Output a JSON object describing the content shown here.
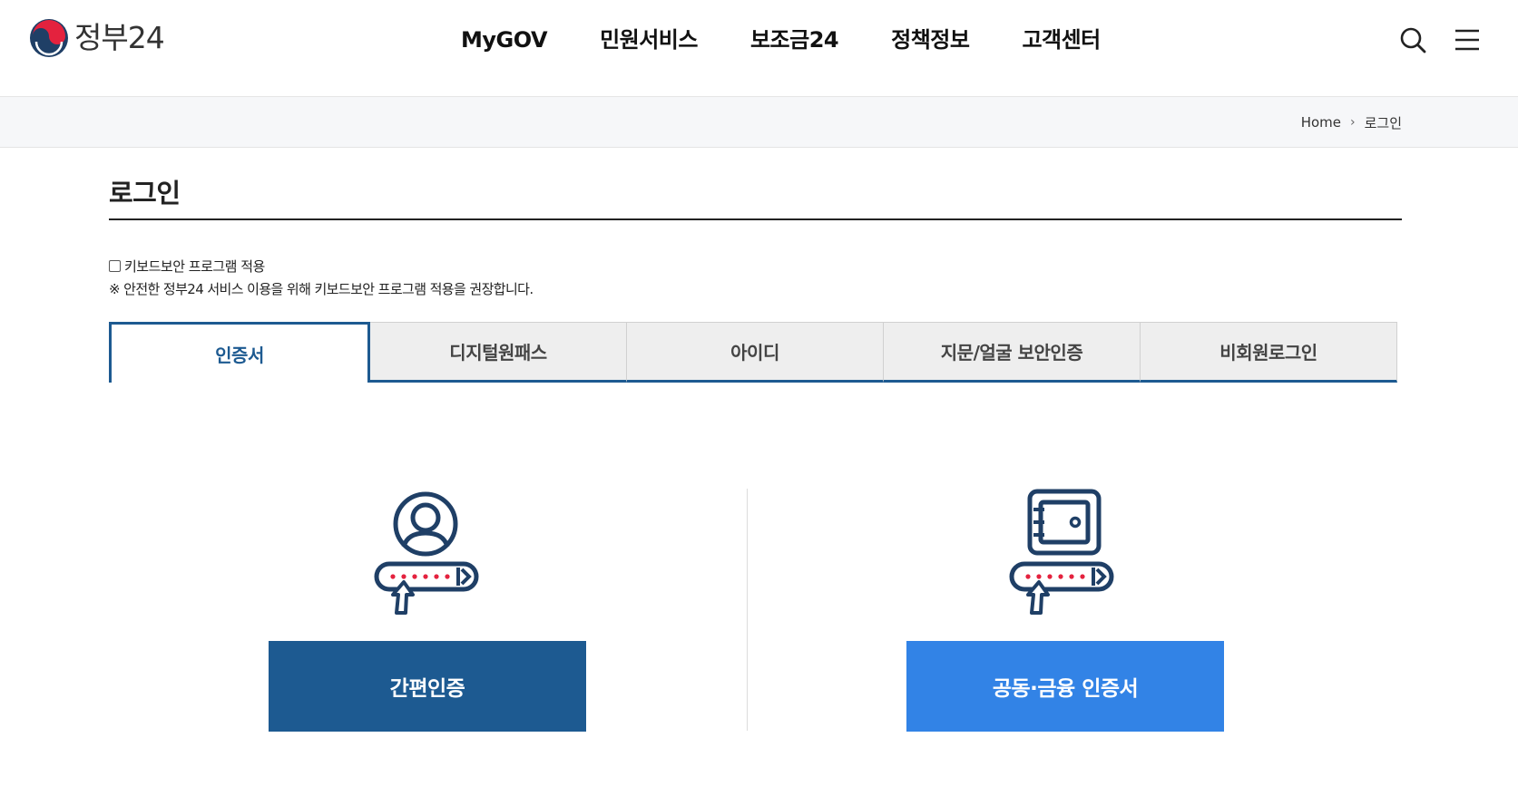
{
  "header": {
    "logo_text": "정부24",
    "nav": [
      "MyGOV",
      "민원서비스",
      "보조금24",
      "정책정보",
      "고객센터"
    ]
  },
  "breadcrumb": {
    "home": "Home",
    "current": "로그인"
  },
  "page": {
    "title": "로그인"
  },
  "keyboard_security": {
    "label": "키보드보안 프로그램 적용",
    "checked": false,
    "note": "※ 안전한 정부24 서비스 이용을 위해 키보드보안 프로그램 적용을 권장합니다."
  },
  "tabs": [
    {
      "label": "인증서",
      "active": true
    },
    {
      "label": "디지털원패스",
      "active": false
    },
    {
      "label": "아이디",
      "active": false
    },
    {
      "label": "지문/얼굴 보안인증",
      "active": false
    },
    {
      "label": "비회원로그인",
      "active": false
    }
  ],
  "options": {
    "simple_auth_label": "간편인증",
    "certificate_label": "공동·금융 인증서"
  },
  "colors": {
    "primary": "#1d5a91",
    "accent_blue": "#3283e6",
    "icon_dark": "#1f3f66",
    "icon_red": "#e4223e"
  }
}
